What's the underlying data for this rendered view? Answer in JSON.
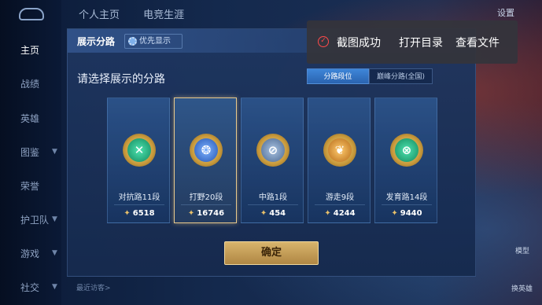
{
  "nav": {
    "items": [
      {
        "label": "主页",
        "active": true
      },
      {
        "label": "战绩"
      },
      {
        "label": "英雄"
      },
      {
        "label": "图鉴"
      },
      {
        "label": "荣誉"
      },
      {
        "label": "护卫队"
      },
      {
        "label": "游戏"
      },
      {
        "label": "社交"
      }
    ]
  },
  "top_tabs": [
    "个人主页",
    "电竞生涯"
  ],
  "settings_label": "设置",
  "bottom": {
    "recent_label": "最近访客>"
  },
  "right_labels": {
    "model": "模型",
    "switch_hero": "换英雄"
  },
  "panel": {
    "title": "展示分路",
    "priority_label": "优先显示",
    "subtitle": "请选择展示的分路",
    "tabs": [
      {
        "label": "分路段位",
        "active": true
      },
      {
        "label": "巅峰分路(全国)"
      }
    ],
    "cards": [
      {
        "label": "对抗路11段",
        "score": "6518",
        "icon": "clash-lane-icon",
        "color": "green",
        "selected": false
      },
      {
        "label": "打野20段",
        "score": "16746",
        "icon": "jungle-icon",
        "color": "blue",
        "selected": true
      },
      {
        "label": "中路1段",
        "score": "454",
        "icon": "mid-lane-icon",
        "color": "slate",
        "selected": false
      },
      {
        "label": "游走9段",
        "score": "4244",
        "icon": "roam-icon",
        "color": "amber",
        "selected": false
      },
      {
        "label": "发育路14段",
        "score": "9440",
        "icon": "farm-lane-icon",
        "color": "green",
        "selected": false
      }
    ],
    "confirm_label": "确定"
  },
  "toast": {
    "message": "截图成功",
    "open_dir_label": "打开目录",
    "view_file_label": "查看文件"
  },
  "colors": {
    "accent_gold": "#e8c98c",
    "tab_active": "#3e86d8",
    "toast_check": "#ff4a4a"
  }
}
